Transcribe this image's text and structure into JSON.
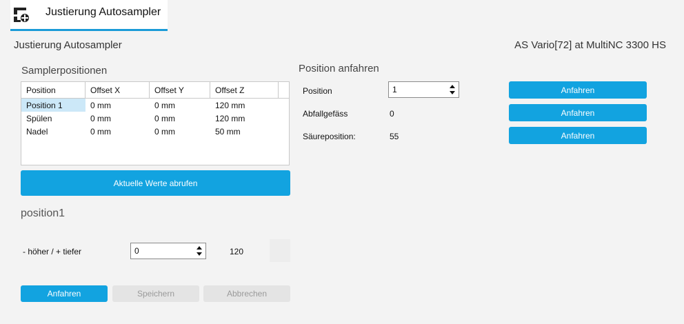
{
  "header": {
    "tab_title": "Justierung Autosampler",
    "tab_icon": "sampler-adjust-icon",
    "accent": "#1a9bd7"
  },
  "page": {
    "title": "Justierung Autosampler",
    "device": "AS Vario[72] at MultiNC 3300 HS"
  },
  "sampler": {
    "title": "Samplerpositionen",
    "columns": [
      "Position",
      "Offset X",
      "Offset Y",
      "Offset Z"
    ],
    "rows": [
      [
        "Position 1",
        "0 mm",
        "0 mm",
        "120 mm"
      ],
      [
        "Spülen",
        "0 mm",
        "0 mm",
        "120 mm"
      ],
      [
        "Nadel",
        "0 mm",
        "0 mm",
        "50 mm"
      ]
    ],
    "selected_row": 0,
    "fetch_button": "Aktuelle Werte abrufen"
  },
  "adjust": {
    "title": "position1",
    "label": "- höher / + tiefer",
    "input_value": "0",
    "current_value": "120",
    "buttons": {
      "move": "Anfahren",
      "save": "Speichern",
      "cancel": "Abbrechen"
    }
  },
  "approach": {
    "title": "Position anfahren",
    "position_label": "Position",
    "position_value": "1",
    "waste_label": "Abfallgefäss",
    "waste_value": "0",
    "acid_label": "Säureposition:",
    "acid_value": "55",
    "button_label": "Anfahren",
    "button_color": "#12a3e0"
  }
}
